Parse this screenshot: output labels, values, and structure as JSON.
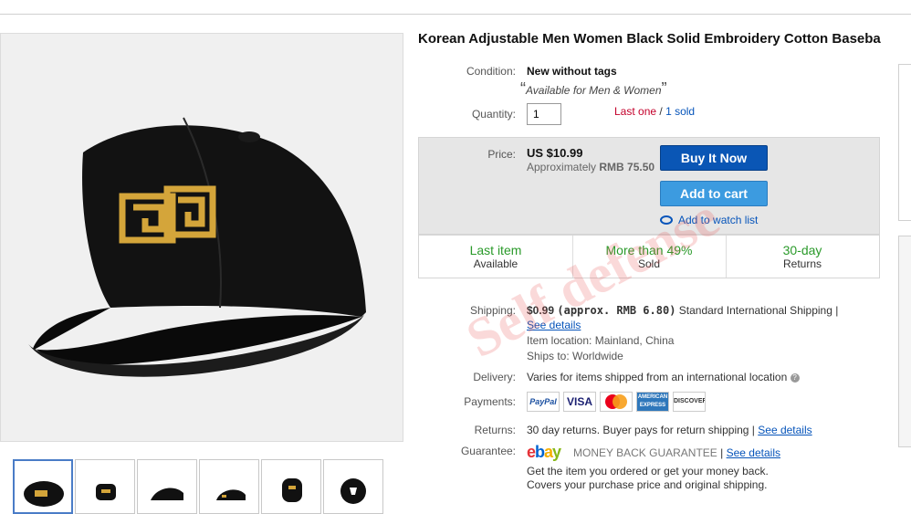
{
  "product": {
    "title": "Korean Adjustable Men Women Black Solid Embroidery Cotton Baseba"
  },
  "condition": {
    "label": "Condition:",
    "value": "New without tags",
    "note": "Available for Men & Women"
  },
  "quantity": {
    "label": "Quantity:",
    "value": "1",
    "last_one": "Last one",
    "sep": " / ",
    "sold": "1 sold"
  },
  "price": {
    "label": "Price:",
    "value": "US $10.99",
    "approx_prefix": "Approximately ",
    "approx_value": "RMB 75.50"
  },
  "buttons": {
    "buy_now": "Buy It Now",
    "add_to_cart": "Add to cart",
    "watch": "Add to watch list"
  },
  "stats": [
    {
      "headline": "Last item",
      "sub": "Available"
    },
    {
      "headline": "More than 49%",
      "sub": "Sold"
    },
    {
      "headline": "30-day",
      "sub": "Returns"
    }
  ],
  "shipping": {
    "label": "Shipping:",
    "cost": "$0.99",
    "approx": "(approx. RMB 6.80)",
    "method": "Standard International Shipping |",
    "details": "See details",
    "location": "Item location:  Mainland, China",
    "ships_to": "Ships to:  Worldwide"
  },
  "delivery": {
    "label": "Delivery:",
    "value": "Varies for items shipped from an international location"
  },
  "payments": {
    "label": "Payments:",
    "methods": [
      "PayPal",
      "VISA",
      "MasterCard",
      "AMERICAN EXPRESS",
      "DISCOVER"
    ]
  },
  "returns": {
    "label": "Returns:",
    "value": "30 day returns. Buyer pays for return shipping |",
    "details": "See details"
  },
  "guarantee": {
    "label": "Guarantee:",
    "brand": "ebay",
    "badge": "MONEY BACK GUARANTEE",
    "sep": "|",
    "details": "See details",
    "line1": "Get the item you ordered or get your money back.",
    "line2": "Covers your purchase price and original shipping."
  },
  "watermark": "Self defense",
  "colors": {
    "buy_now": "#0a56b5",
    "add_to_cart": "#3c9be0",
    "green": "#2a9a2a",
    "red": "#c4002b",
    "link": "#0654ba"
  },
  "icons": {
    "watch": "eye-icon",
    "delivery_info": "info-icon"
  }
}
